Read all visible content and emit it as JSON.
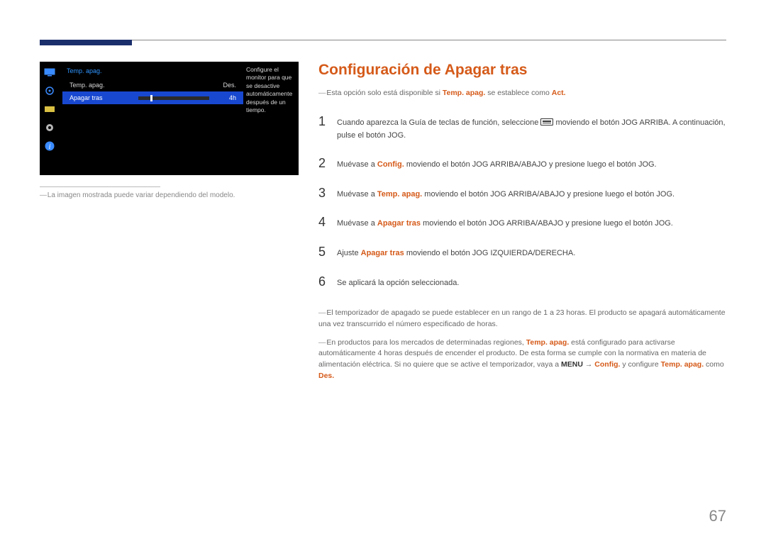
{
  "osd": {
    "header": "Temp. apag.",
    "rows": [
      {
        "label": "Temp. apag.",
        "value": "Des.",
        "selected": false,
        "has_slider": false
      },
      {
        "label": "Apagar tras",
        "value": "4h",
        "selected": true,
        "has_slider": true
      }
    ],
    "description": "Configure el monitor para que se desactive automáticamente después de un tiempo."
  },
  "caption": "La imagen mostrada puede variar dependiendo del modelo.",
  "title": "Configuración de Apagar tras",
  "note_top_pre": "Esta opción solo está disponible si ",
  "note_top_bold1": "Temp. apag.",
  "note_top_mid": " se establece como ",
  "note_top_bold2": "Act.",
  "steps": {
    "1": {
      "pre": "Cuando aparezca la Guía de teclas de función, seleccione ",
      "post": " moviendo el botón JOG ARRIBA. A continuación, pulse el botón JOG."
    },
    "2": {
      "pre": "Muévase a ",
      "bold": "Config.",
      "post": " moviendo el botón JOG ARRIBA/ABAJO y presione luego el botón JOG."
    },
    "3": {
      "pre": "Muévase a ",
      "bold": "Temp. apag.",
      "post": " moviendo el botón JOG ARRIBA/ABAJO y presione luego el botón JOG."
    },
    "4": {
      "pre": "Muévase a ",
      "bold": "Apagar tras",
      "post": " moviendo el botón JOG ARRIBA/ABAJO y presione luego el botón JOG."
    },
    "5": {
      "pre": "Ajuste ",
      "bold": "Apagar tras",
      "post": " moviendo el botón JOG IZQUIERDA/DERECHA."
    },
    "6": {
      "text": "Se aplicará la opción seleccionada."
    }
  },
  "footnote1": "El temporizador de apagado se puede establecer en un rango de 1 a 23 horas. El producto se apagará automáticamente una vez transcurrido el número especificado de horas.",
  "footnote2": {
    "a": "En productos para los mercados de determinadas regiones, ",
    "b": "Temp. apag.",
    "c": " está configurado para activarse automáticamente 4 horas después de encender el producto. De esta forma se cumple con la normativa en materia de alimentación eléctrica. Si no quiere que se active el temporizador, vaya a ",
    "d": "MENU",
    "e": "Config.",
    "f": " y configure ",
    "g": "Temp. apag.",
    "h": " como ",
    "i": "Des."
  },
  "page_number": "67"
}
